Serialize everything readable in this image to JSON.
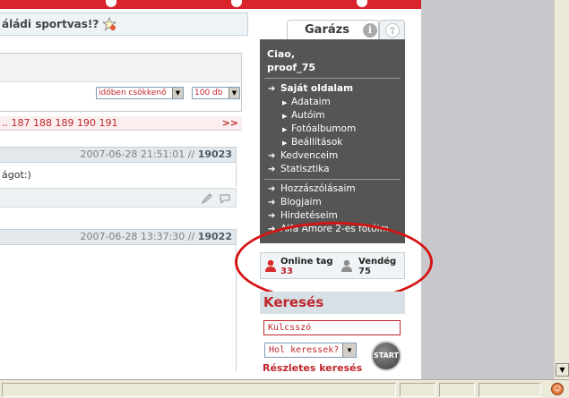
{
  "content": {
    "title": "áládi sportvas!?",
    "filters": {
      "sort_value": "időben csökkenő",
      "per_page_value": "100 db"
    },
    "pager": {
      "pages_text": "..  187  188  189  190  191",
      "next_label": ">>"
    },
    "entry1": {
      "datetime": "2007-06-28 21:51:01 //",
      "id": "19023",
      "body_text": "ágot:)"
    },
    "entry2": {
      "datetime": "2007-06-28 13:37:30 //",
      "id": "19022"
    }
  },
  "sidebar": {
    "tab_label": "Garázs",
    "info_symbol": "i",
    "greeting_line1": "Ciao,",
    "greeting_line2": "proof_75",
    "menu": {
      "own_page": "Saját oldalam",
      "adataim": "Adataim",
      "autoim": "Autóim",
      "fotoalbumom": "Fotóalbumom",
      "beallitasok": "Beállítások",
      "kedvenceim": "Kedvenceim",
      "statisztika": "Statisztika",
      "hozzaszolasaim": "Hozzászólásaim",
      "blogjaim": "Blogjaim",
      "hirdeteseim": "Hirdetéseim",
      "alfa": "Alfa Amore 2-es fotóim"
    },
    "online": {
      "tag_label": "Online tag",
      "tag_count": "33",
      "guest_label": "Vendég",
      "guest_count": "75"
    },
    "search": {
      "title": "Keresés",
      "keyword_placeholder": "Kulcsszó",
      "where_value": "Hol keressek?",
      "start_label": "START",
      "detailed_link": "Részletes keresés"
    }
  },
  "colors": {
    "brand_red": "#c0262d",
    "panel_dark": "#555555",
    "highlight_ellipse": "#d41414"
  }
}
